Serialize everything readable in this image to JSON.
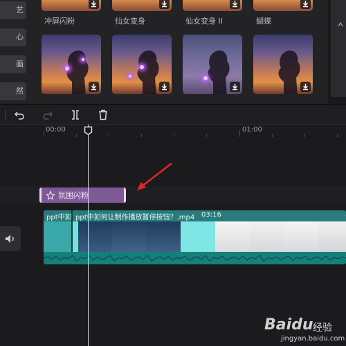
{
  "sidebar": {
    "items": [
      "艺",
      "心",
      "画",
      "然"
    ]
  },
  "effects": {
    "row1_labels": [
      "冲屏闪粉",
      "仙女变身",
      "仙女变身 II",
      "蝴蝶"
    ]
  },
  "toolbar": {
    "undo_icon": "undo-icon",
    "redo_icon": "redo-icon",
    "split_icon": "split-icon",
    "delete_icon": "trash-icon"
  },
  "timeline": {
    "ruler_start": "00:00",
    "ruler_mid": "01:00",
    "effect_clip_label": "氛围闪粉",
    "video_clip_short": "ppt中如",
    "video_clip_name": "ppt中如何让制作播放暂停按钮？.mp4",
    "video_clip_duration": "03:16"
  },
  "watermark": {
    "brand": "Baidu",
    "brand_cn": "经验",
    "url": "jingyan.baidu.com"
  },
  "colors": {
    "effect_clip": "#7d5a96",
    "video_track": "#1a6a6a",
    "arrow": "#e0262b",
    "background": "#1b1b1d"
  }
}
